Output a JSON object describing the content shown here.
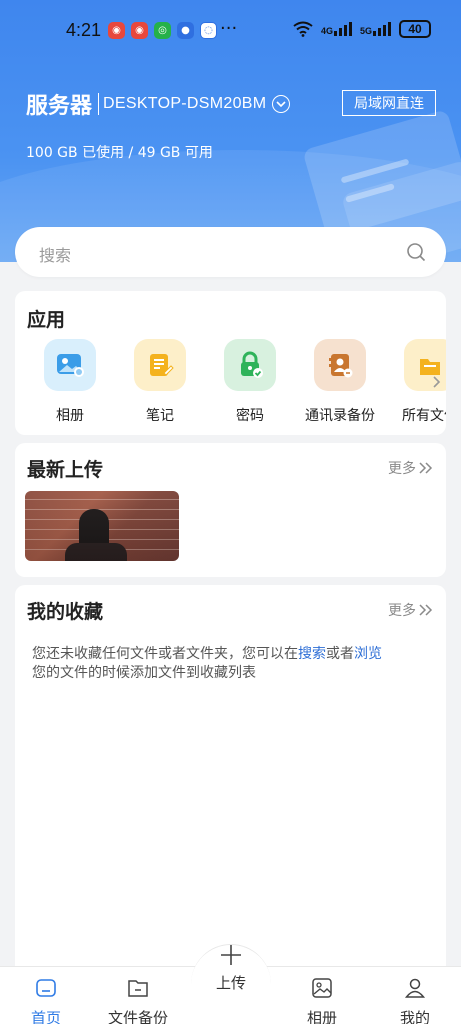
{
  "status_bar": {
    "time": "4:21",
    "more": "···",
    "signal_1": "4G",
    "signal_2": "5G",
    "battery": "40",
    "app_icons": [
      "weibo-icon",
      "weibo-icon",
      "app-icon",
      "app-icon",
      "chat-icon"
    ]
  },
  "header": {
    "server_label": "服务器",
    "server_name": "DESKTOP-DSM20BM",
    "lan_button": "局域网直连",
    "usage": "100 GB 已使用 / 49 GB 可用"
  },
  "search": {
    "placeholder": "搜索"
  },
  "apps": {
    "title": "应用",
    "items": [
      {
        "label": "相册",
        "icon": "photo-icon",
        "bg": "#d9effc",
        "fg": "#3b9de8"
      },
      {
        "label": "笔记",
        "icon": "note-icon",
        "bg": "#fdefc9",
        "fg": "#f4b21e"
      },
      {
        "label": "密码",
        "icon": "lock-icon",
        "bg": "#d8f1df",
        "fg": "#2fb35a"
      },
      {
        "label": "通讯录备份",
        "icon": "contacts-icon",
        "bg": "#f6e1cf",
        "fg": "#c9762f"
      },
      {
        "label": "所有文件",
        "icon": "folder-icon",
        "bg": "#fdefc9",
        "fg": "#f4b21e"
      }
    ]
  },
  "recent": {
    "title": "最新上传",
    "more": "更多"
  },
  "favorites": {
    "title": "我的收藏",
    "more": "更多",
    "msg_part1": "您还未收藏任何文件或者文件夹，您可以在",
    "msg_link1": "搜索",
    "msg_part2": "或者",
    "msg_link2": "浏览",
    "msg_part3": "您的文件的时候添加文件到收藏列表"
  },
  "tabbar": {
    "items": [
      "首页",
      "文件备份",
      "上传",
      "相册",
      "我的"
    ],
    "active_index": 0
  },
  "colors": {
    "accent": "#2f7be5",
    "header_bg": "#4089ef",
    "link": "#2f6fd6"
  }
}
